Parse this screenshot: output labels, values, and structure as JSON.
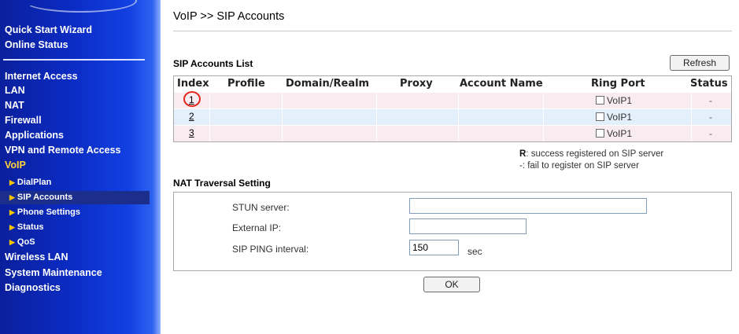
{
  "sidebar": {
    "items": [
      {
        "label": "Quick Start Wizard"
      },
      {
        "label": "Online Status"
      },
      {
        "label": "Internet Access"
      },
      {
        "label": "LAN"
      },
      {
        "label": "NAT"
      },
      {
        "label": "Firewall"
      },
      {
        "label": "Applications"
      },
      {
        "label": "VPN and Remote Access"
      },
      {
        "label": "VoIP"
      },
      {
        "label": "Wireless LAN"
      },
      {
        "label": "System Maintenance"
      },
      {
        "label": "Diagnostics"
      }
    ],
    "voip_subitems": [
      {
        "label": "DialPlan"
      },
      {
        "label": "SIP Accounts"
      },
      {
        "label": "Phone Settings"
      },
      {
        "label": "Status"
      },
      {
        "label": "QoS"
      }
    ],
    "active_section": "VoIP",
    "selected_subitem": "SIP Accounts"
  },
  "page": {
    "title": "VoIP >> SIP Accounts"
  },
  "sip_list": {
    "title": "SIP Accounts List",
    "refresh_label": "Refresh",
    "headers": [
      "Index",
      "Profile",
      "Domain/Realm",
      "Proxy",
      "Account Name",
      "Ring Port",
      "Status"
    ],
    "rows": [
      {
        "index": "1",
        "profile": "",
        "domain": "",
        "proxy": "",
        "account": "",
        "ring_port": "VoIP1",
        "status": "-"
      },
      {
        "index": "2",
        "profile": "",
        "domain": "",
        "proxy": "",
        "account": "",
        "ring_port": "VoIP1",
        "status": "-"
      },
      {
        "index": "3",
        "profile": "",
        "domain": "",
        "proxy": "",
        "account": "",
        "ring_port": "VoIP1",
        "status": "-"
      }
    ],
    "legend": {
      "r_key": "R",
      "r_text": ": success registered on SIP server",
      "dash_text": "-: fail to register on SIP server"
    }
  },
  "nat": {
    "title": "NAT Traversal Setting",
    "stun_label": "STUN server:",
    "stun_value": "",
    "external_ip_label": "External IP:",
    "external_ip_value": "",
    "ping_label": "SIP PING interval:",
    "ping_value": "150",
    "ping_unit": "sec"
  },
  "ok_label": "OK",
  "colors": {
    "sidebar_blue": "#0b2cc4",
    "active_yellow": "#ffd23a",
    "row_pink": "#f8ecf1",
    "row_blue": "#e3effa",
    "highlight_red": "#e0281d"
  }
}
